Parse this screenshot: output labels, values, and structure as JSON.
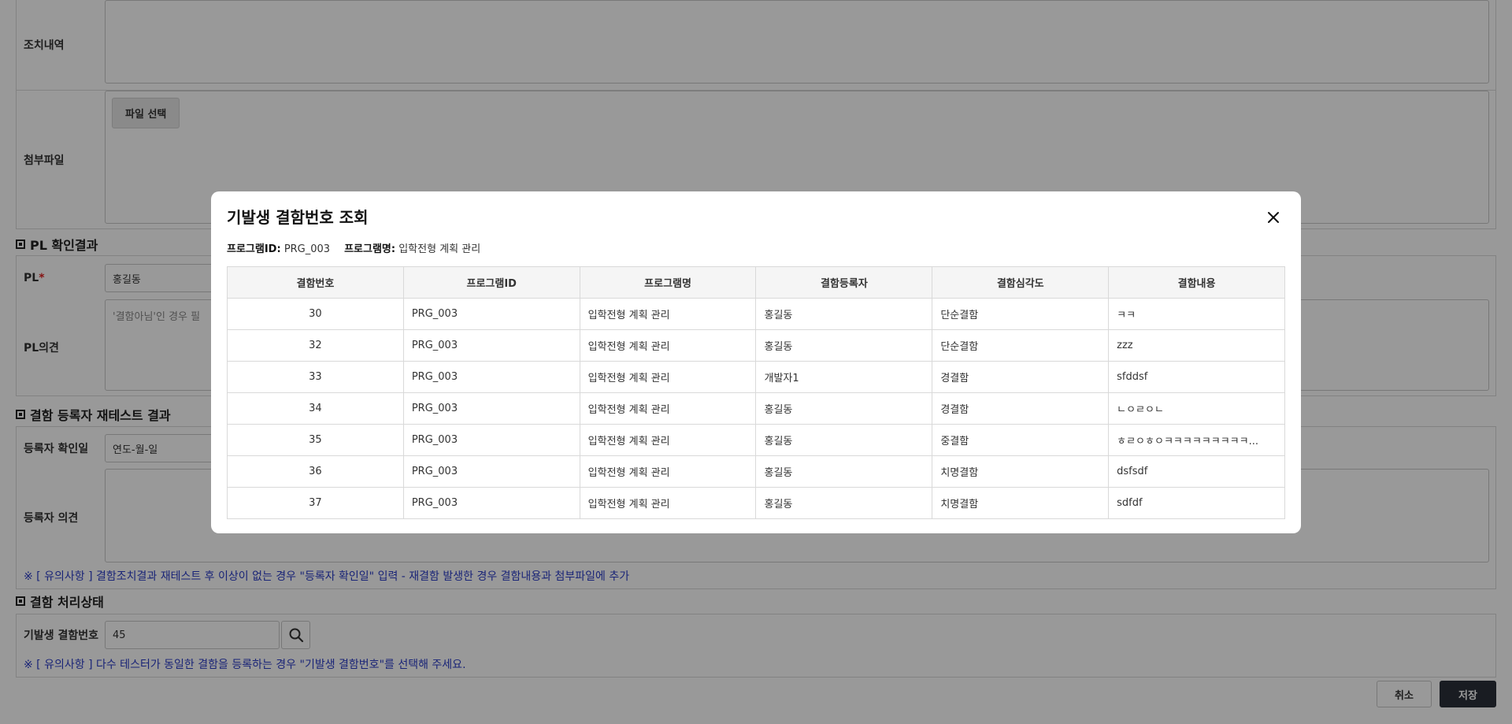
{
  "form": {
    "action_label": "조치내역",
    "attach_label": "첨부파일",
    "file_button": "파일 선택",
    "pl_section": "PL 확인결과",
    "pl_label": "PL",
    "pl_required": "*",
    "pl_value": "홍길동",
    "pl_opinion_label": "PL의견",
    "pl_opinion_placeholder": "'결함아님'인 경우 필",
    "retest_section": "결함 등록자 재테스트 결과",
    "reg_confirm_label": "등록자 확인일",
    "reg_confirm_value": "연도-월-일",
    "reg_opinion_label": "등록자 의견",
    "retest_notice": "※ [ 유의사항 ] 결함조치결과 재테스트 후 이상이 없는 경우 \"등록자 확인일\" 입력 - 재결함 발생한 경우 결함내용과 첨부파일에 추가",
    "status_section": "결함 처리상태",
    "prev_defect_label": "기발생 결함번호",
    "prev_defect_value": "45",
    "status_notice": "※ [ 유의사항 ] 다수 테스터가 동일한 결함을 등록하는 경우 \"기발생 결함번호\"를 선택해 주세요.",
    "cancel_label": "취소",
    "save_label": "저장"
  },
  "modal": {
    "title": "기발생 결함번호 조회",
    "program_id_label": "프로그램ID:",
    "program_id_value": "PRG_003",
    "program_name_label": "프로그램명:",
    "program_name_value": "입학전형 계획 관리",
    "columns": [
      "결함번호",
      "프로그램ID",
      "프로그램명",
      "결함등록자",
      "결함심각도",
      "결함내용"
    ],
    "rows": [
      [
        "30",
        "PRG_003",
        "입학전형 계획 관리",
        "홍길동",
        "단순결함",
        "ㅋㅋ"
      ],
      [
        "32",
        "PRG_003",
        "입학전형 계획 관리",
        "홍길동",
        "단순결함",
        "zzz"
      ],
      [
        "33",
        "PRG_003",
        "입학전형 계획 관리",
        "개발자1",
        "경결함",
        "sfddsf"
      ],
      [
        "34",
        "PRG_003",
        "입학전형 계획 관리",
        "홍길동",
        "경결함",
        "ㄴㅇㄹㅇㄴ"
      ],
      [
        "35",
        "PRG_003",
        "입학전형 계획 관리",
        "홍길동",
        "중결함",
        "ㅎㄹㅇㅎㅇㅋㅋㅋㅋㅋㅋㅋㅋㅋ..."
      ],
      [
        "36",
        "PRG_003",
        "입학전형 계획 관리",
        "홍길동",
        "치명결함",
        "dsfsdf"
      ],
      [
        "37",
        "PRG_003",
        "입학전형 계획 관리",
        "홍길동",
        "치명결함",
        "sdfdf"
      ]
    ]
  }
}
